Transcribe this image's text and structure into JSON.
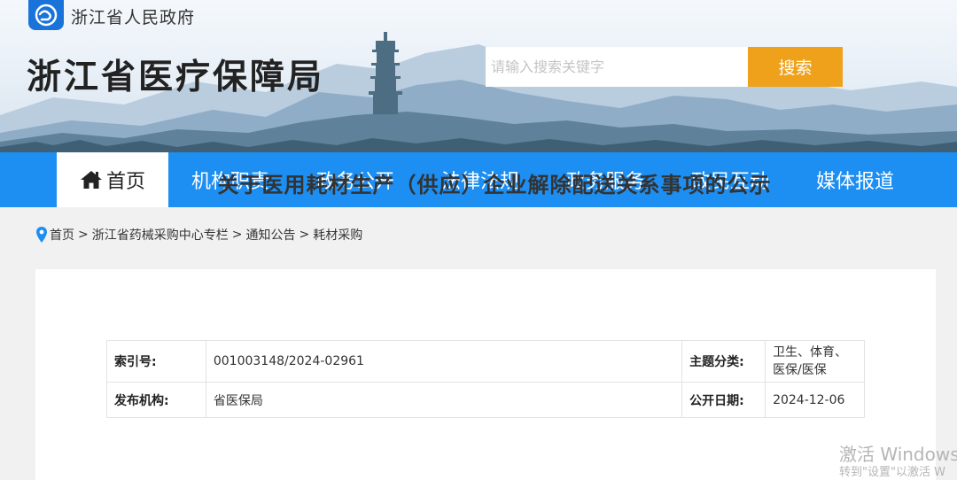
{
  "header": {
    "gov_name": "浙江省人民政府",
    "site_title": "浙江省医疗保障局",
    "logo_icon": "zhejiang-gov-logo",
    "search": {
      "placeholder": "请输入搜索关键字",
      "value": "",
      "button_label": "搜索"
    }
  },
  "nav": {
    "items": [
      {
        "label": "首页",
        "active": true,
        "icon": "home-icon"
      },
      {
        "label": "机构职责"
      },
      {
        "label": "政务公开"
      },
      {
        "label": "法律法规"
      },
      {
        "label": "政务服务"
      },
      {
        "label": "政民互动"
      },
      {
        "label": "媒体报道"
      }
    ]
  },
  "breadcrumb": {
    "icon": "location-pin-icon",
    "items": [
      "首页",
      "浙江省药械采购中心专栏",
      "通知公告",
      "耗材采购"
    ],
    "separator": ">"
  },
  "meta": {
    "index_label": "索引号:",
    "index_value": "001003148/2024-02961",
    "topic_label": "主题分类:",
    "topic_value": "卫生、体育、医保/医保",
    "publisher_label": "发布机构:",
    "publisher_value": "省医保局",
    "date_label": "公开日期:",
    "date_value": "2024-12-06"
  },
  "article": {
    "title": "关于医用耗材生产（供应）企业解除配送关系事项的公示"
  },
  "watermark": {
    "line1": "激活 Windows",
    "line2": "转到\"设置\"以激活 W"
  },
  "colors": {
    "nav_bg": "#1d8ef2",
    "search_button": "#f0a11c",
    "logo_bg": "#1a73d9"
  }
}
